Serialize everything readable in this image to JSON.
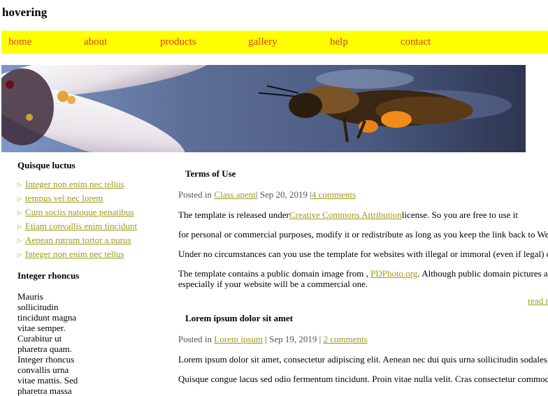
{
  "site": {
    "title": "hovering"
  },
  "nav": {
    "items": [
      "home",
      "about",
      "products",
      "gallery",
      "help",
      "contact"
    ]
  },
  "colors": {
    "nav_bg": "#ffff00",
    "nav_text": "#d9401e",
    "link": "#9b9b1a"
  },
  "hero": {
    "icon": "bee-photo"
  },
  "sidebar": {
    "heading1": "Quisque luctus",
    "links": [
      " Integer non enim nec tellus",
      "tempus vel nec lorem",
      "Cum sociis natoque penatibus",
      "Etiam convallis enim tincidunt",
      "Aenean rutrum tortor a purus",
      "Integer non enim nec tellus"
    ],
    "heading2": "Integer rhoncus",
    "text": "Mauris sollicitudin tincidunt magna vitae semper. Curabitur ut pharetra quam. Integer rhoncus convallis urna vitae mattis. Sed pharetra massa"
  },
  "posts": [
    {
      "title": "Terms of Use",
      "meta_prefix": "Posted in ",
      "category": "Class apent",
      "date": "| Sep 20, 2019 |",
      "comments": "4 comments",
      "p1_before": "The template is released under",
      "p1_link": "Creative Commons Attribution",
      "p1_after": "license. So you are free to use it",
      "p2": "for personal or commercial purposes, modify it or redistribute as long as you keep the link back to WebTe",
      "p3": "Under no circumstances can you use the template for websites with illegal or immoral (even if legal) cont",
      "p4_before": "The template contains a public domain image from , ",
      "p4_link": "PDPhoto.org",
      "p4_after": ". Although public domain pictures are fr",
      "p4_line2": "especially if your website will be a commercial one.",
      "read_more": "read r"
    },
    {
      "title": "Lorem ipsum dolor sit amet",
      "meta_prefix": "Posted in ",
      "category": "Lorem ipsum",
      "date": " | Sep 19, 2019 | ",
      "comments": "2 comments",
      "p1": "Lorem ipsum dolor sit amet, consectetur adipiscing elit. Aenean nec dui quis urna sollicitudin sodales. Fus",
      "p2": "Quisque congue lacus sed odio fermentum tincidunt. Proin vitae nulla velit. Cras consectetur commodo sc"
    }
  ]
}
